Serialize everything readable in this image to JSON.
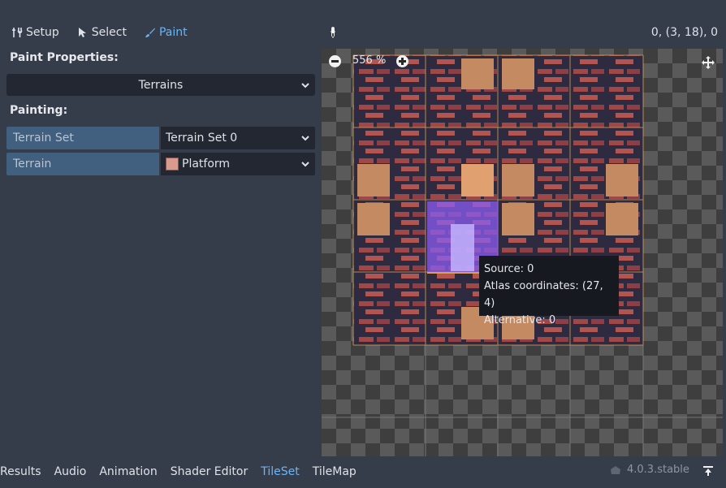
{
  "toolbar": {
    "setup_label": "Setup",
    "select_label": "Select",
    "paint_label": "Paint"
  },
  "status": {
    "coordinates": "0, (3, 18), 0"
  },
  "paint_properties": {
    "heading": "Paint Properties:",
    "mode_value": "Terrains"
  },
  "painting": {
    "heading": "Painting:",
    "rows": [
      {
        "name": "Terrain Set",
        "value": "Terrain Set 0"
      },
      {
        "name": "Terrain",
        "value": "Platform"
      }
    ]
  },
  "viewport": {
    "zoom_label": "556 %"
  },
  "tooltip": {
    "source": "Source: 0",
    "atlas": "Atlas coordinates: (27, 4)",
    "alternative": "Alternative: 0"
  },
  "bottom_tabs": [
    {
      "label": "Results"
    },
    {
      "label": "Audio"
    },
    {
      "label": "Animation"
    },
    {
      "label": "Shader Editor"
    },
    {
      "label": "TileSet",
      "active": true
    },
    {
      "label": "TileMap"
    }
  ],
  "version": "4.0.3.stable",
  "colors": {
    "accent": "#6ab4f5",
    "panel": "#363d4a",
    "field": "#222732",
    "property_name_bg": "#41607f",
    "brick": "#a04848",
    "tile_bg": "#2e2a40",
    "highlight": "#e0a04a"
  },
  "icons": [
    "setup-icon",
    "select-arrow-icon",
    "paint-brush-icon",
    "eyedropper-icon",
    "chevron-down-icon",
    "zoom-out-icon",
    "zoom-in-icon",
    "pan-move-icon",
    "godot-logo-icon",
    "pin-icon"
  ]
}
